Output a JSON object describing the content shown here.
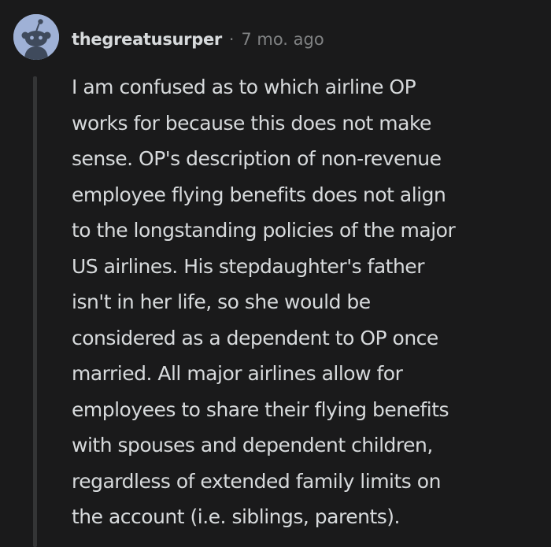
{
  "comment": {
    "username": "thegreatusurper",
    "separator": "·",
    "timestamp": "7 mo. ago",
    "avatar_icon": "snoo-avatar-icon",
    "colors": {
      "background": "#1a1a1b",
      "text": "#d7dadc",
      "meta": "#818384",
      "avatar_bg": "#9fb1d6",
      "thread_line": "#343536"
    },
    "body_lines": [
      "I am confused as to which airline OP",
      "works for because this does not make",
      "sense. OP's description of non-revenue",
      "employee flying benefits does not align",
      "to the longstanding policies of the major",
      "US airlines. His stepdaughter's father",
      "isn't in her life, so she would be",
      "considered as a dependent to OP once",
      "married. All major airlines allow for",
      "employees to share their flying benefits",
      "with spouses and dependent children,",
      "regardless of extended family limits on",
      "the account (i.e. siblings, parents)."
    ]
  }
}
